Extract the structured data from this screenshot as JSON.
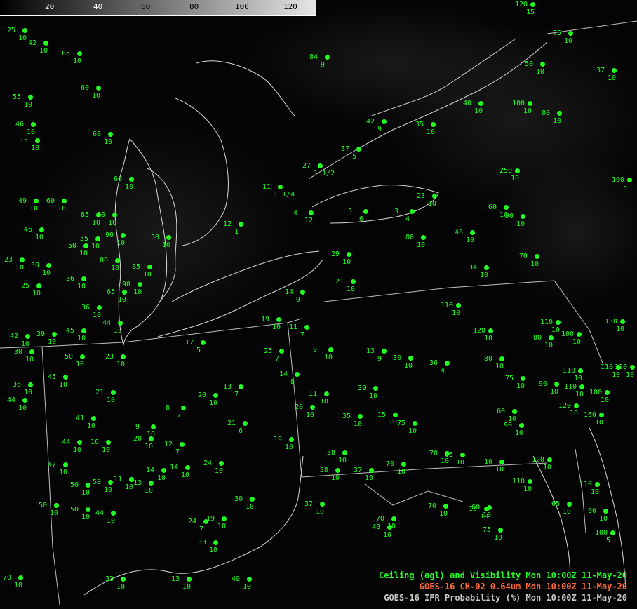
{
  "colorbar": {
    "ticks": [
      "20",
      "40",
      "60",
      "80",
      "100",
      "120"
    ]
  },
  "legend": {
    "lines": [
      {
        "text": "Ceiling (agl) and Visibility  Mon 10:00Z 11-May-20",
        "color": "#22ff22"
      },
      {
        "text": "GOES-16 CH-02 0.64um  Mon 10:00Z 11-May-20",
        "color": "#ff6a3a"
      },
      {
        "text": "GOES-16 IFR Probability (%)  Mon 10:00Z 11-May-20",
        "color": "#c8c8c8"
      }
    ]
  },
  "stations": [
    {
      "c": "25",
      "v": "10"
    },
    {
      "c": "42",
      "v": "10"
    },
    {
      "c": "85",
      "v": "10"
    },
    {
      "c": "60",
      "v": "10"
    },
    {
      "c": "55",
      "v": "10"
    },
    {
      "c": "46",
      "v": "10"
    },
    {
      "c": "60",
      "v": "10"
    },
    {
      "c": "15",
      "v": "10"
    },
    {
      "c": "60",
      "v": "10"
    },
    {
      "c": "50",
      "v": "10"
    },
    {
      "c": "49",
      "v": "10"
    },
    {
      "c": "60",
      "v": "10"
    },
    {
      "c": "85",
      "v": "10"
    },
    {
      "c": "50",
      "v": "10"
    },
    {
      "c": "46",
      "v": "10"
    },
    {
      "c": "55",
      "v": "10"
    },
    {
      "c": "90",
      "v": "10"
    },
    {
      "c": "50",
      "v": "10"
    },
    {
      "c": "23",
      "v": "10"
    },
    {
      "c": "39",
      "v": "10"
    },
    {
      "c": "80",
      "v": "10"
    },
    {
      "c": "85",
      "v": "10"
    },
    {
      "c": "25",
      "v": "10"
    },
    {
      "c": "36",
      "v": "10"
    },
    {
      "c": "65",
      "v": "10"
    },
    {
      "c": "90",
      "v": "10"
    },
    {
      "c": "36",
      "v": "10"
    },
    {
      "c": "44",
      "v": "10"
    },
    {
      "c": "42",
      "v": "10"
    },
    {
      "c": "39",
      "v": "10"
    },
    {
      "c": "45",
      "v": "10"
    },
    {
      "c": "30",
      "v": "10"
    },
    {
      "c": "50",
      "v": "10"
    },
    {
      "c": "23",
      "v": "10"
    },
    {
      "c": "45",
      "v": "10"
    },
    {
      "c": "36",
      "v": "10"
    },
    {
      "c": "44",
      "v": "10"
    },
    {
      "c": "41",
      "v": "10"
    },
    {
      "c": "21",
      "v": "10"
    },
    {
      "c": "44",
      "v": "10"
    },
    {
      "c": "16",
      "v": "10"
    },
    {
      "c": "9",
      "v": "10"
    },
    {
      "c": "20",
      "v": "10"
    },
    {
      "c": "12",
      "v": "7"
    },
    {
      "c": "8",
      "v": "7"
    },
    {
      "c": "20",
      "v": "10"
    },
    {
      "c": "13",
      "v": "7"
    },
    {
      "c": "21",
      "v": "6"
    },
    {
      "c": "47",
      "v": "10"
    },
    {
      "c": "50",
      "v": "10"
    },
    {
      "c": "50",
      "v": "10"
    },
    {
      "c": "11",
      "v": "10"
    },
    {
      "c": "14",
      "v": "10"
    },
    {
      "c": "14",
      "v": "10"
    },
    {
      "c": "24",
      "v": "10"
    },
    {
      "c": "13",
      "v": "10"
    },
    {
      "c": "50",
      "v": "10"
    },
    {
      "c": "50",
      "v": "10"
    },
    {
      "c": "44",
      "v": "10"
    },
    {
      "c": "30",
      "v": "10"
    },
    {
      "c": "24",
      "v": "7"
    },
    {
      "c": "19",
      "v": "10"
    },
    {
      "c": "33",
      "v": "10"
    },
    {
      "c": "70",
      "v": "10"
    },
    {
      "c": "33",
      "v": "10"
    },
    {
      "c": "13",
      "v": "10"
    },
    {
      "c": "49",
      "v": "10"
    },
    {
      "c": "37",
      "v": "10"
    },
    {
      "c": "38",
      "v": "10"
    },
    {
      "c": "37",
      "v": "10"
    },
    {
      "c": "70",
      "v": "10"
    },
    {
      "c": "65",
      "v": "10"
    },
    {
      "c": "48",
      "v": "10"
    },
    {
      "c": "60",
      "v": "10"
    },
    {
      "c": "80",
      "v": "10"
    },
    {
      "c": "84",
      "v": "9"
    },
    {
      "c": "42",
      "v": "9"
    },
    {
      "c": "35",
      "v": "10"
    },
    {
      "c": "37",
      "v": "5"
    },
    {
      "c": "27",
      "v": "1 1/2"
    },
    {
      "c": "11",
      "v": "1 1/4"
    },
    {
      "c": "12",
      "v": "1"
    },
    {
      "c": "4",
      "v": "12"
    },
    {
      "c": "5",
      "v": "6"
    },
    {
      "c": "3",
      "v": "4"
    },
    {
      "c": "23",
      "v": "10"
    },
    {
      "c": "29",
      "v": "10"
    },
    {
      "c": "21",
      "v": "10"
    },
    {
      "c": "14",
      "v": "9"
    },
    {
      "c": "19",
      "v": "10"
    },
    {
      "c": "11",
      "v": "7"
    },
    {
      "c": "17",
      "v": "5"
    },
    {
      "c": "25",
      "v": "7"
    },
    {
      "c": "14",
      "v": "8"
    },
    {
      "c": "9",
      "v": "10"
    },
    {
      "c": "13",
      "v": "9"
    },
    {
      "c": "30",
      "v": "10"
    },
    {
      "c": "36",
      "v": "4"
    },
    {
      "c": "11",
      "v": "10"
    },
    {
      "c": "39",
      "v": "10"
    },
    {
      "c": "20",
      "v": "10"
    },
    {
      "c": "35",
      "v": "10"
    },
    {
      "c": "15",
      "v": "10"
    },
    {
      "c": "75",
      "v": "10"
    },
    {
      "c": "19",
      "v": "10"
    },
    {
      "c": "38",
      "v": "10"
    },
    {
      "c": "70",
      "v": "10"
    },
    {
      "c": "70",
      "v": "10"
    },
    {
      "c": "10",
      "v": "10"
    },
    {
      "c": "70",
      "v": "10"
    },
    {
      "c": "10",
      "v": "10"
    },
    {
      "c": "75",
      "v": "10"
    },
    {
      "c": "80",
      "v": "10"
    },
    {
      "c": "60",
      "v": "10"
    },
    {
      "c": "48",
      "v": "10"
    },
    {
      "c": "90",
      "v": "10"
    },
    {
      "c": "34",
      "v": "10"
    },
    {
      "c": "70",
      "v": "10"
    },
    {
      "c": "80",
      "v": "10"
    },
    {
      "c": "110",
      "v": "10"
    },
    {
      "c": "120",
      "v": "10"
    },
    {
      "c": "110",
      "v": "10"
    },
    {
      "c": "100",
      "v": "10"
    },
    {
      "c": "80",
      "v": "10"
    },
    {
      "c": "110",
      "v": "10"
    },
    {
      "c": "75",
      "v": "10"
    },
    {
      "c": "90",
      "v": "10"
    },
    {
      "c": "110",
      "v": "10"
    },
    {
      "c": "120",
      "v": "10"
    },
    {
      "c": "60",
      "v": "10"
    },
    {
      "c": "160",
      "v": "10"
    },
    {
      "c": "120",
      "v": "10"
    },
    {
      "c": "100",
      "v": "10"
    },
    {
      "c": "120",
      "v": "10"
    },
    {
      "c": "110",
      "v": "10"
    },
    {
      "c": "100",
      "v": "5"
    },
    {
      "c": "120",
      "v": "15"
    },
    {
      "c": "75",
      "v": "10"
    },
    {
      "c": "50",
      "v": "10"
    },
    {
      "c": "37",
      "v": "10"
    },
    {
      "c": "40",
      "v": "10"
    },
    {
      "c": "100",
      "v": "10"
    },
    {
      "c": "250",
      "v": "10"
    },
    {
      "c": "100",
      "v": "5"
    },
    {
      "c": "90",
      "v": "10"
    },
    {
      "c": "110",
      "v": "10"
    },
    {
      "c": "130",
      "v": "10"
    },
    {
      "c": "110",
      "v": "10"
    },
    {
      "c": "65",
      "v": "10"
    },
    {
      "c": "90",
      "v": "10"
    }
  ]
}
